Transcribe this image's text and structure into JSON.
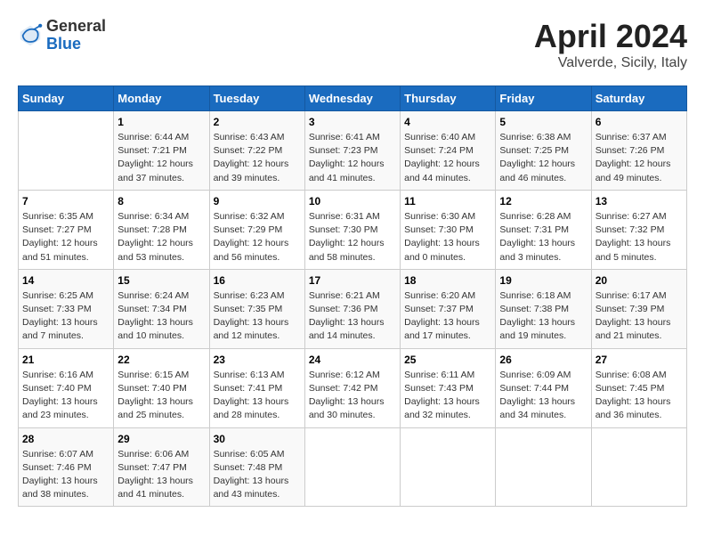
{
  "header": {
    "logo_general": "General",
    "logo_blue": "Blue",
    "month_title": "April 2024",
    "location": "Valverde, Sicily, Italy"
  },
  "days_of_week": [
    "Sunday",
    "Monday",
    "Tuesday",
    "Wednesday",
    "Thursday",
    "Friday",
    "Saturday"
  ],
  "weeks": [
    [
      {
        "day": "",
        "info": ""
      },
      {
        "day": "1",
        "info": "Sunrise: 6:44 AM\nSunset: 7:21 PM\nDaylight: 12 hours\nand 37 minutes."
      },
      {
        "day": "2",
        "info": "Sunrise: 6:43 AM\nSunset: 7:22 PM\nDaylight: 12 hours\nand 39 minutes."
      },
      {
        "day": "3",
        "info": "Sunrise: 6:41 AM\nSunset: 7:23 PM\nDaylight: 12 hours\nand 41 minutes."
      },
      {
        "day": "4",
        "info": "Sunrise: 6:40 AM\nSunset: 7:24 PM\nDaylight: 12 hours\nand 44 minutes."
      },
      {
        "day": "5",
        "info": "Sunrise: 6:38 AM\nSunset: 7:25 PM\nDaylight: 12 hours\nand 46 minutes."
      },
      {
        "day": "6",
        "info": "Sunrise: 6:37 AM\nSunset: 7:26 PM\nDaylight: 12 hours\nand 49 minutes."
      }
    ],
    [
      {
        "day": "7",
        "info": "Sunrise: 6:35 AM\nSunset: 7:27 PM\nDaylight: 12 hours\nand 51 minutes."
      },
      {
        "day": "8",
        "info": "Sunrise: 6:34 AM\nSunset: 7:28 PM\nDaylight: 12 hours\nand 53 minutes."
      },
      {
        "day": "9",
        "info": "Sunrise: 6:32 AM\nSunset: 7:29 PM\nDaylight: 12 hours\nand 56 minutes."
      },
      {
        "day": "10",
        "info": "Sunrise: 6:31 AM\nSunset: 7:30 PM\nDaylight: 12 hours\nand 58 minutes."
      },
      {
        "day": "11",
        "info": "Sunrise: 6:30 AM\nSunset: 7:30 PM\nDaylight: 13 hours\nand 0 minutes."
      },
      {
        "day": "12",
        "info": "Sunrise: 6:28 AM\nSunset: 7:31 PM\nDaylight: 13 hours\nand 3 minutes."
      },
      {
        "day": "13",
        "info": "Sunrise: 6:27 AM\nSunset: 7:32 PM\nDaylight: 13 hours\nand 5 minutes."
      }
    ],
    [
      {
        "day": "14",
        "info": "Sunrise: 6:25 AM\nSunset: 7:33 PM\nDaylight: 13 hours\nand 7 minutes."
      },
      {
        "day": "15",
        "info": "Sunrise: 6:24 AM\nSunset: 7:34 PM\nDaylight: 13 hours\nand 10 minutes."
      },
      {
        "day": "16",
        "info": "Sunrise: 6:23 AM\nSunset: 7:35 PM\nDaylight: 13 hours\nand 12 minutes."
      },
      {
        "day": "17",
        "info": "Sunrise: 6:21 AM\nSunset: 7:36 PM\nDaylight: 13 hours\nand 14 minutes."
      },
      {
        "day": "18",
        "info": "Sunrise: 6:20 AM\nSunset: 7:37 PM\nDaylight: 13 hours\nand 17 minutes."
      },
      {
        "day": "19",
        "info": "Sunrise: 6:18 AM\nSunset: 7:38 PM\nDaylight: 13 hours\nand 19 minutes."
      },
      {
        "day": "20",
        "info": "Sunrise: 6:17 AM\nSunset: 7:39 PM\nDaylight: 13 hours\nand 21 minutes."
      }
    ],
    [
      {
        "day": "21",
        "info": "Sunrise: 6:16 AM\nSunset: 7:40 PM\nDaylight: 13 hours\nand 23 minutes."
      },
      {
        "day": "22",
        "info": "Sunrise: 6:15 AM\nSunset: 7:40 PM\nDaylight: 13 hours\nand 25 minutes."
      },
      {
        "day": "23",
        "info": "Sunrise: 6:13 AM\nSunset: 7:41 PM\nDaylight: 13 hours\nand 28 minutes."
      },
      {
        "day": "24",
        "info": "Sunrise: 6:12 AM\nSunset: 7:42 PM\nDaylight: 13 hours\nand 30 minutes."
      },
      {
        "day": "25",
        "info": "Sunrise: 6:11 AM\nSunset: 7:43 PM\nDaylight: 13 hours\nand 32 minutes."
      },
      {
        "day": "26",
        "info": "Sunrise: 6:09 AM\nSunset: 7:44 PM\nDaylight: 13 hours\nand 34 minutes."
      },
      {
        "day": "27",
        "info": "Sunrise: 6:08 AM\nSunset: 7:45 PM\nDaylight: 13 hours\nand 36 minutes."
      }
    ],
    [
      {
        "day": "28",
        "info": "Sunrise: 6:07 AM\nSunset: 7:46 PM\nDaylight: 13 hours\nand 38 minutes."
      },
      {
        "day": "29",
        "info": "Sunrise: 6:06 AM\nSunset: 7:47 PM\nDaylight: 13 hours\nand 41 minutes."
      },
      {
        "day": "30",
        "info": "Sunrise: 6:05 AM\nSunset: 7:48 PM\nDaylight: 13 hours\nand 43 minutes."
      },
      {
        "day": "",
        "info": ""
      },
      {
        "day": "",
        "info": ""
      },
      {
        "day": "",
        "info": ""
      },
      {
        "day": "",
        "info": ""
      }
    ]
  ]
}
